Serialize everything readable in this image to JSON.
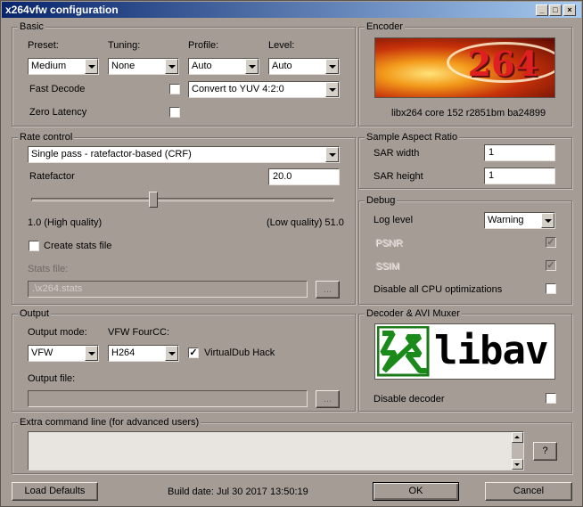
{
  "window": {
    "title": "x264vfw configuration"
  },
  "basic": {
    "legend": "Basic",
    "preset_label": "Preset:",
    "preset_value": "Medium",
    "tuning_label": "Tuning:",
    "tuning_value": "None",
    "profile_label": "Profile:",
    "profile_value": "Auto",
    "level_label": "Level:",
    "level_value": "Auto",
    "fast_decode_label": "Fast Decode",
    "fast_decode_checked": false,
    "zero_latency_label": "Zero Latency",
    "zero_latency_checked": false,
    "colorspace_value": "Convert to YUV 4:2:0"
  },
  "encoder": {
    "legend": "Encoder",
    "logo_text": "264",
    "version": "libx264 core 152 r2851bm ba24899"
  },
  "rate_control": {
    "legend": "Rate control",
    "mode_value": "Single pass - ratefactor-based (CRF)",
    "ratefactor_label": "Ratefactor",
    "ratefactor_value": "20.0",
    "slider_fraction": 0.4,
    "min_label": "1.0 (High quality)",
    "max_label": "(Low quality) 51.0",
    "create_stats_label": "Create stats file",
    "create_stats_checked": false,
    "stats_file_label": "Stats file:",
    "stats_file_value": ".\\x264.stats",
    "browse_label": "..."
  },
  "sar": {
    "legend": "Sample Aspect Ratio",
    "width_label": "SAR width",
    "width_value": "1",
    "height_label": "SAR height",
    "height_value": "1"
  },
  "debug": {
    "legend": "Debug",
    "log_level_label": "Log level",
    "log_level_value": "Warning",
    "psnr_label": "PSNR",
    "ssim_label": "SSIM",
    "disable_cpu_label": "Disable all CPU optimizations"
  },
  "output": {
    "legend": "Output",
    "mode_label": "Output mode:",
    "mode_value": "VFW",
    "fourcc_label": "VFW FourCC:",
    "fourcc_value": "H264",
    "vdub_label": "VirtualDub Hack",
    "vdub_checked": true,
    "file_label": "Output file:",
    "file_value": "",
    "browse_label": "..."
  },
  "decoder": {
    "legend": "Decoder & AVI Muxer",
    "logo_text": "libav",
    "disable_label": "Disable decoder"
  },
  "extra": {
    "legend": "Extra command line (for advanced users)",
    "value": "",
    "help_label": "?"
  },
  "footer": {
    "load_defaults": "Load Defaults",
    "build_date": "Build date: Jul 30 2017 13:50:19",
    "ok": "OK",
    "cancel": "Cancel"
  }
}
